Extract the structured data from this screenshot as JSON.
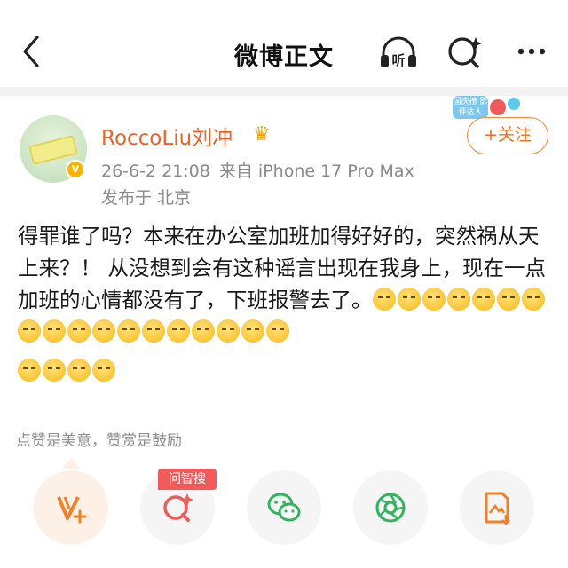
{
  "nav": {
    "title": "微博正文",
    "listen_label": "听"
  },
  "post": {
    "username": "RoccoLiu刘冲",
    "date": "26-6-2 21:08",
    "source": "来自 iPhone 17 Pro Max",
    "location": "发布于 北京",
    "follow_label": "+关注",
    "badge_label": "国庆榜 影评达人",
    "text": "得罪谁了吗？本来在办公室加班加得好好的，突然祸从天上来？！ 从没想到会有这种谣言出现在我身上，现在一点加班的心情都没有了，下班报警去了。",
    "emoji_icon": "sleepy-face-emoji",
    "emoji_count_line1": 18,
    "emoji_count_line2": 4
  },
  "reward": {
    "text": "点赞是美意，赞赏是鼓励"
  },
  "actions": {
    "zhisou_label": "问智搜",
    "icons": [
      "vplus-icon",
      "search-sparkle-icon",
      "wechat-icon",
      "moments-icon",
      "save-image-icon"
    ]
  },
  "colors": {
    "accent": "#f06f1e",
    "username": "#e8642b",
    "meta": "#8a8a8a",
    "badge_red": "#f25a5a"
  }
}
